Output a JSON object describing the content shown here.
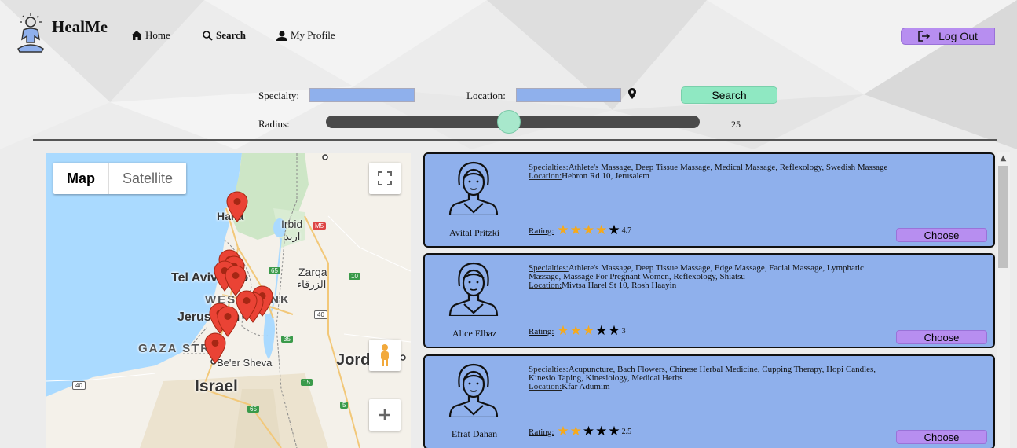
{
  "app": {
    "name": "HealMe"
  },
  "nav": {
    "home": "Home",
    "search": "Search",
    "profile": "My Profile",
    "logout": "Log Out"
  },
  "search": {
    "specialty_label": "Specialty:",
    "specialty_value": "",
    "location_label": "Location:",
    "location_value": "",
    "button": "Search",
    "radius_label": "Radius:",
    "radius_value": "25",
    "radius_fraction": 0.49
  },
  "map": {
    "map_tab": "Map",
    "satellite_tab": "Satellite",
    "labels": {
      "haifa": "Haifa",
      "irbid": "Irbid",
      "irbid_ar": "اربد",
      "zarqa": "Zarqa",
      "zarqa_ar": "الزرقاء",
      "tel_aviv": "Tel Aviv-Yafo",
      "west_bank": "WEST BANK",
      "jerusalem": "Jerusalem",
      "gaza": "GAZA STRIP",
      "beer_sheva": "Be'er Sheva",
      "jordan": "Jordan",
      "israel": "Israel"
    },
    "roads": [
      "M5",
      "65",
      "40",
      "35",
      "15",
      "40",
      "10",
      "5",
      "65"
    ],
    "marker_count": 11
  },
  "providers": [
    {
      "name": "Avital Pritzki",
      "specialties_label": "Specialties:",
      "specialties": "Athlete's Massage, Deep Tissue Massage, Medical Massage, Reflexology, Swedish Massage",
      "location_label": "Location:",
      "location": "Hebron Rd 10, Jerusalem",
      "rating_label": "Rating:",
      "rating": "4.7",
      "stars_filled": 4,
      "choose": "Choose"
    },
    {
      "name": "Alice Elbaz",
      "specialties_label": "Specialties:",
      "specialties": "Athlete's Massage, Deep Tissue Massage, Edge Massage, Facial Massage, Lymphatic Massage, Massage For Pregnant Women, Reflexology, Shiatsu",
      "location_label": "Location:",
      "location": "Mivtsa Harel St 10, Rosh Haayin",
      "rating_label": "Rating:",
      "rating": "3",
      "stars_filled": 3,
      "choose": "Choose"
    },
    {
      "name": "Efrat Dahan",
      "specialties_label": "Specialties:",
      "specialties": "Acupuncture, Bach Flowers, Chinese Herbal Medicine, Cupping Therapy, Hopi Candles, Kinesio Taping, Kinesiology, Medical Herbs",
      "location_label": "Location:",
      "location": "Kfar Adumim",
      "rating_label": "Rating:",
      "rating": "2.5",
      "stars_filled": 2,
      "choose": "Choose"
    }
  ],
  "colors": {
    "card_bg": "#8fb0ec",
    "accent_purple": "#b78ef0",
    "accent_green": "#8fe8c2",
    "star_gold": "#f6a91b"
  }
}
